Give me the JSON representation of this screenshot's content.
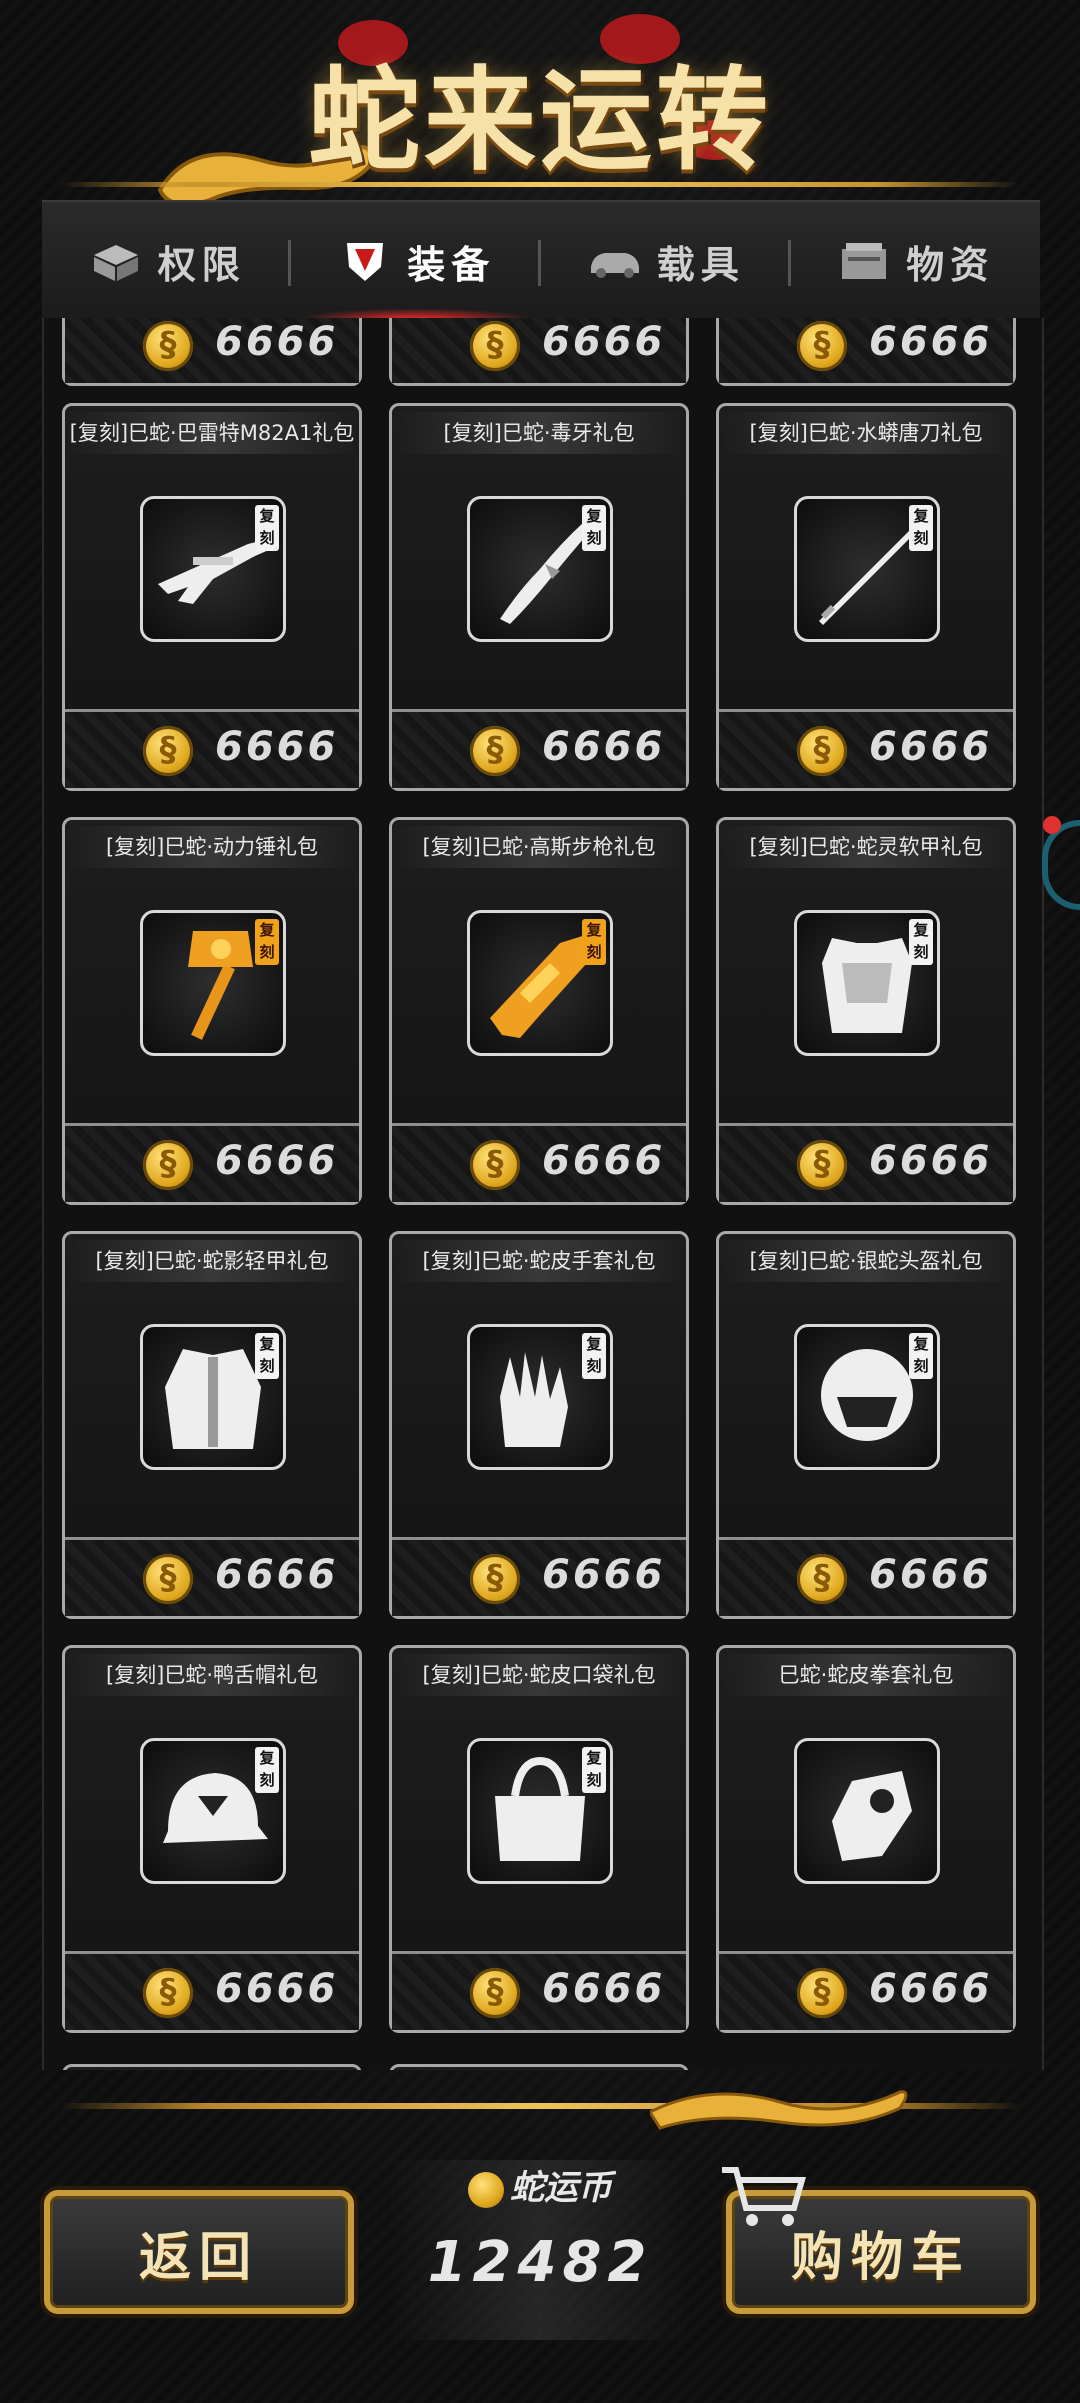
{
  "title": "蛇来运转",
  "tabs": [
    {
      "label": "权限",
      "icon": "gift-box-icon"
    },
    {
      "label": "装备",
      "icon": "shield-icon",
      "active": true
    },
    {
      "label": "载具",
      "icon": "car-icon"
    },
    {
      "label": "物资",
      "icon": "crate-icon"
    }
  ],
  "partial_row": {
    "prices": [
      "6666",
      "6666",
      "6666"
    ]
  },
  "items": [
    {
      "name": "[复刻]巳蛇·巴雷特M82A1礼包",
      "price": "6666",
      "tag": "复刻",
      "icon": "sniper-rifle-icon"
    },
    {
      "name": "[复刻]巳蛇·毒牙礼包",
      "price": "6666",
      "tag": "复刻",
      "icon": "fang-blade-icon"
    },
    {
      "name": "[复刻]巳蛇·水蟒唐刀礼包",
      "price": "6666",
      "tag": "复刻",
      "icon": "katana-icon"
    },
    {
      "name": "[复刻]巳蛇·动力锤礼包",
      "price": "6666",
      "tag": "复刻",
      "icon": "power-hammer-icon",
      "gold": true
    },
    {
      "name": "[复刻]巳蛇·高斯步枪礼包",
      "price": "6666",
      "tag": "复刻",
      "icon": "gauss-rifle-icon",
      "gold": true
    },
    {
      "name": "[复刻]巳蛇·蛇灵软甲礼包",
      "price": "6666",
      "tag": "复刻",
      "icon": "soft-armor-icon"
    },
    {
      "name": "[复刻]巳蛇·蛇影轻甲礼包",
      "price": "6666",
      "tag": "复刻",
      "icon": "light-armor-icon"
    },
    {
      "name": "[复刻]巳蛇·蛇皮手套礼包",
      "price": "6666",
      "tag": "复刻",
      "icon": "gloves-icon"
    },
    {
      "name": "[复刻]巳蛇·银蛇头盔礼包",
      "price": "6666",
      "tag": "复刻",
      "icon": "helmet-icon"
    },
    {
      "name": "[复刻]巳蛇·鸭舌帽礼包",
      "price": "6666",
      "tag": "复刻",
      "icon": "cap-icon"
    },
    {
      "name": "[复刻]巳蛇·蛇皮口袋礼包",
      "price": "6666",
      "tag": "复刻",
      "icon": "bag-icon"
    },
    {
      "name": "巳蛇·蛇皮拳套礼包",
      "price": "6666",
      "tag": "",
      "icon": "fist-icon"
    }
  ],
  "footer": {
    "back_label": "返回",
    "cart_label": "购物车",
    "currency_label": "蛇运币",
    "currency_value": "12482"
  },
  "colors": {
    "gold": "#f0c35a",
    "accent_red": "#ff2a2a",
    "card_border": "#a9a9a9"
  }
}
